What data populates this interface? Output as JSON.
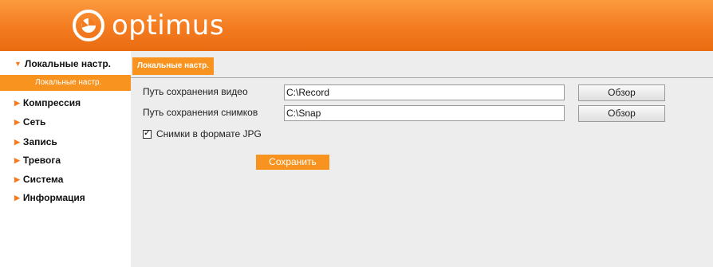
{
  "header": {
    "brand": "optimus",
    "logo_icon": "optimus-logo-icon",
    "background_color": "#f47b20"
  },
  "sidebar": {
    "items": [
      {
        "label": "Локальные настр.",
        "expanded": true,
        "arrow": "▼"
      },
      {
        "label": "Компрессия",
        "expanded": false,
        "arrow": "▶"
      },
      {
        "label": "Сеть",
        "expanded": false,
        "arrow": "▶"
      },
      {
        "label": "Запись",
        "expanded": false,
        "arrow": "▶"
      },
      {
        "label": "Тревога",
        "expanded": false,
        "arrow": "▶"
      },
      {
        "label": "Система",
        "expanded": false,
        "arrow": "▶"
      },
      {
        "label": "Информация",
        "expanded": false,
        "arrow": "▶"
      }
    ],
    "submenu": {
      "label": "Локальные настр.",
      "selected": true
    },
    "accent_color": "#f7931e"
  },
  "main": {
    "tab_label": "Локальные настр.",
    "video_path": {
      "label": "Путь сохранения видео",
      "value": "C:\\Record",
      "button": "Обзор"
    },
    "snapshot_path": {
      "label": "Путь сохранения снимков",
      "value": "C:\\Snap",
      "button": "Обзор"
    },
    "jpg_option": {
      "label": "Снимки в формате JPG",
      "checked": true
    },
    "save_button": "Сохранить"
  }
}
